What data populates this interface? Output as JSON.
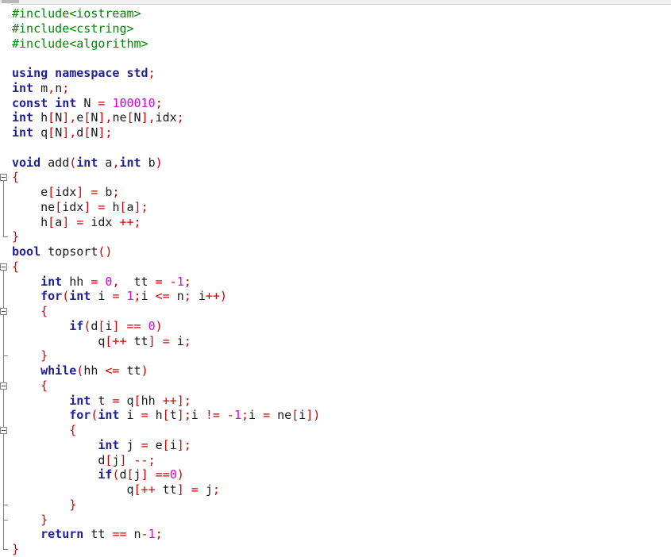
{
  "editor": {
    "lines": [
      [
        {
          "t": "#include<iostream>",
          "c": "pp"
        }
      ],
      [
        {
          "t": "#include<cstring>",
          "c": "pp"
        }
      ],
      [
        {
          "t": "#include<algorithm>",
          "c": "pp"
        }
      ],
      [],
      [
        {
          "t": "using namespace std",
          "c": "kw"
        },
        {
          "t": ";",
          "c": "pu"
        }
      ],
      [
        {
          "t": "int ",
          "c": "ty"
        },
        {
          "t": "m",
          "c": "ident"
        },
        {
          "t": ",",
          "c": "pu"
        },
        {
          "t": "n",
          "c": "ident"
        },
        {
          "t": ";",
          "c": "pu"
        }
      ],
      [
        {
          "t": "const int ",
          "c": "ty"
        },
        {
          "t": "N ",
          "c": "ident"
        },
        {
          "t": "= ",
          "c": "pu"
        },
        {
          "t": "100010",
          "c": "num"
        },
        {
          "t": ";",
          "c": "pu"
        }
      ],
      [
        {
          "t": "int ",
          "c": "ty"
        },
        {
          "t": "h",
          "c": "ident"
        },
        {
          "t": "[",
          "c": "pu"
        },
        {
          "t": "N",
          "c": "ident"
        },
        {
          "t": "],",
          "c": "pu"
        },
        {
          "t": "e",
          "c": "ident"
        },
        {
          "t": "[",
          "c": "pu"
        },
        {
          "t": "N",
          "c": "ident"
        },
        {
          "t": "],",
          "c": "pu"
        },
        {
          "t": "ne",
          "c": "ident"
        },
        {
          "t": "[",
          "c": "pu"
        },
        {
          "t": "N",
          "c": "ident"
        },
        {
          "t": "],",
          "c": "pu"
        },
        {
          "t": "idx",
          "c": "ident"
        },
        {
          "t": ";",
          "c": "pu"
        }
      ],
      [
        {
          "t": "int ",
          "c": "ty"
        },
        {
          "t": "q",
          "c": "ident"
        },
        {
          "t": "[",
          "c": "pu"
        },
        {
          "t": "N",
          "c": "ident"
        },
        {
          "t": "],",
          "c": "pu"
        },
        {
          "t": "d",
          "c": "ident"
        },
        {
          "t": "[",
          "c": "pu"
        },
        {
          "t": "N",
          "c": "ident"
        },
        {
          "t": "];",
          "c": "pu"
        }
      ],
      [],
      [
        {
          "t": "void ",
          "c": "ty"
        },
        {
          "t": "add",
          "c": "ident"
        },
        {
          "t": "(",
          "c": "pu"
        },
        {
          "t": "int ",
          "c": "ty"
        },
        {
          "t": "a",
          "c": "ident"
        },
        {
          "t": ",",
          "c": "pu"
        },
        {
          "t": "int ",
          "c": "ty"
        },
        {
          "t": "b",
          "c": "ident"
        },
        {
          "t": ")",
          "c": "pu"
        }
      ],
      [
        {
          "t": "{",
          "c": "pu"
        }
      ],
      [
        {
          "t": "    e",
          "c": "ident"
        },
        {
          "t": "[",
          "c": "pu"
        },
        {
          "t": "idx",
          "c": "ident"
        },
        {
          "t": "] = ",
          "c": "pu"
        },
        {
          "t": "b",
          "c": "ident"
        },
        {
          "t": ";",
          "c": "pu"
        }
      ],
      [
        {
          "t": "    ne",
          "c": "ident"
        },
        {
          "t": "[",
          "c": "pu"
        },
        {
          "t": "idx",
          "c": "ident"
        },
        {
          "t": "] = ",
          "c": "pu"
        },
        {
          "t": "h",
          "c": "ident"
        },
        {
          "t": "[",
          "c": "pu"
        },
        {
          "t": "a",
          "c": "ident"
        },
        {
          "t": "];",
          "c": "pu"
        }
      ],
      [
        {
          "t": "    h",
          "c": "ident"
        },
        {
          "t": "[",
          "c": "pu"
        },
        {
          "t": "a",
          "c": "ident"
        },
        {
          "t": "] = ",
          "c": "pu"
        },
        {
          "t": "idx ",
          "c": "ident"
        },
        {
          "t": "++;",
          "c": "pu"
        }
      ],
      [
        {
          "t": "}",
          "c": "pu"
        }
      ],
      [
        {
          "t": "bool ",
          "c": "ty"
        },
        {
          "t": "topsort",
          "c": "ident"
        },
        {
          "t": "()",
          "c": "pu"
        }
      ],
      [
        {
          "t": "{",
          "c": "pu"
        }
      ],
      [
        {
          "t": "    ",
          "c": "ident"
        },
        {
          "t": "int ",
          "c": "ty"
        },
        {
          "t": "hh ",
          "c": "ident"
        },
        {
          "t": "= ",
          "c": "pu"
        },
        {
          "t": "0",
          "c": "num"
        },
        {
          "t": ",  ",
          "c": "pu"
        },
        {
          "t": "tt ",
          "c": "ident"
        },
        {
          "t": "= -",
          "c": "pu"
        },
        {
          "t": "1",
          "c": "num"
        },
        {
          "t": ";",
          "c": "pu"
        }
      ],
      [
        {
          "t": "    ",
          "c": "ident"
        },
        {
          "t": "for",
          "c": "kw"
        },
        {
          "t": "(",
          "c": "pu"
        },
        {
          "t": "int ",
          "c": "ty"
        },
        {
          "t": "i ",
          "c": "ident"
        },
        {
          "t": "= ",
          "c": "pu"
        },
        {
          "t": "1",
          "c": "num"
        },
        {
          "t": ";",
          "c": "pu"
        },
        {
          "t": "i ",
          "c": "ident"
        },
        {
          "t": "<= ",
          "c": "pu"
        },
        {
          "t": "n",
          "c": "ident"
        },
        {
          "t": "; ",
          "c": "pu"
        },
        {
          "t": "i",
          "c": "ident"
        },
        {
          "t": "++)",
          "c": "pu"
        }
      ],
      [
        {
          "t": "    {",
          "c": "pu"
        }
      ],
      [
        {
          "t": "        ",
          "c": "ident"
        },
        {
          "t": "if",
          "c": "kw"
        },
        {
          "t": "(",
          "c": "pu"
        },
        {
          "t": "d",
          "c": "ident"
        },
        {
          "t": "[",
          "c": "pu"
        },
        {
          "t": "i",
          "c": "ident"
        },
        {
          "t": "] == ",
          "c": "pu"
        },
        {
          "t": "0",
          "c": "num"
        },
        {
          "t": ")",
          "c": "pu"
        }
      ],
      [
        {
          "t": "            q",
          "c": "ident"
        },
        {
          "t": "[++ ",
          "c": "pu"
        },
        {
          "t": "tt",
          "c": "ident"
        },
        {
          "t": "] = ",
          "c": "pu"
        },
        {
          "t": "i",
          "c": "ident"
        },
        {
          "t": ";",
          "c": "pu"
        }
      ],
      [
        {
          "t": "    }",
          "c": "pu"
        }
      ],
      [
        {
          "t": "    ",
          "c": "ident"
        },
        {
          "t": "while",
          "c": "kw"
        },
        {
          "t": "(",
          "c": "pu"
        },
        {
          "t": "hh ",
          "c": "ident"
        },
        {
          "t": "<= ",
          "c": "pu"
        },
        {
          "t": "tt",
          "c": "ident"
        },
        {
          "t": ")",
          "c": "pu"
        }
      ],
      [
        {
          "t": "    {",
          "c": "pu"
        }
      ],
      [
        {
          "t": "        ",
          "c": "ident"
        },
        {
          "t": "int ",
          "c": "ty"
        },
        {
          "t": "t ",
          "c": "ident"
        },
        {
          "t": "= ",
          "c": "pu"
        },
        {
          "t": "q",
          "c": "ident"
        },
        {
          "t": "[",
          "c": "pu"
        },
        {
          "t": "hh ",
          "c": "ident"
        },
        {
          "t": "++];",
          "c": "pu"
        }
      ],
      [
        {
          "t": "        ",
          "c": "ident"
        },
        {
          "t": "for",
          "c": "kw"
        },
        {
          "t": "(",
          "c": "pu"
        },
        {
          "t": "int ",
          "c": "ty"
        },
        {
          "t": "i ",
          "c": "ident"
        },
        {
          "t": "= ",
          "c": "pu"
        },
        {
          "t": "h",
          "c": "ident"
        },
        {
          "t": "[",
          "c": "pu"
        },
        {
          "t": "t",
          "c": "ident"
        },
        {
          "t": "];",
          "c": "pu"
        },
        {
          "t": "i ",
          "c": "ident"
        },
        {
          "t": "!= -",
          "c": "pu"
        },
        {
          "t": "1",
          "c": "num"
        },
        {
          "t": ";",
          "c": "pu"
        },
        {
          "t": "i ",
          "c": "ident"
        },
        {
          "t": "= ",
          "c": "pu"
        },
        {
          "t": "ne",
          "c": "ident"
        },
        {
          "t": "[",
          "c": "pu"
        },
        {
          "t": "i",
          "c": "ident"
        },
        {
          "t": "])",
          "c": "pu"
        }
      ],
      [
        {
          "t": "        {",
          "c": "pu"
        }
      ],
      [
        {
          "t": "            ",
          "c": "ident"
        },
        {
          "t": "int ",
          "c": "ty"
        },
        {
          "t": "j ",
          "c": "ident"
        },
        {
          "t": "= ",
          "c": "pu"
        },
        {
          "t": "e",
          "c": "ident"
        },
        {
          "t": "[",
          "c": "pu"
        },
        {
          "t": "i",
          "c": "ident"
        },
        {
          "t": "];",
          "c": "pu"
        }
      ],
      [
        {
          "t": "            d",
          "c": "ident"
        },
        {
          "t": "[",
          "c": "pu"
        },
        {
          "t": "j",
          "c": "ident"
        },
        {
          "t": "] --;",
          "c": "pu"
        }
      ],
      [
        {
          "t": "            ",
          "c": "ident"
        },
        {
          "t": "if",
          "c": "kw"
        },
        {
          "t": "(",
          "c": "pu"
        },
        {
          "t": "d",
          "c": "ident"
        },
        {
          "t": "[",
          "c": "pu"
        },
        {
          "t": "j",
          "c": "ident"
        },
        {
          "t": "] ==",
          "c": "pu"
        },
        {
          "t": "0",
          "c": "num"
        },
        {
          "t": ")",
          "c": "pu"
        }
      ],
      [
        {
          "t": "                q",
          "c": "ident"
        },
        {
          "t": "[++ ",
          "c": "pu"
        },
        {
          "t": "tt",
          "c": "ident"
        },
        {
          "t": "] = ",
          "c": "pu"
        },
        {
          "t": "j",
          "c": "ident"
        },
        {
          "t": ";",
          "c": "pu"
        }
      ],
      [
        {
          "t": "        }",
          "c": "pu"
        }
      ],
      [
        {
          "t": "    }",
          "c": "pu"
        }
      ],
      [
        {
          "t": "    ",
          "c": "ident"
        },
        {
          "t": "return ",
          "c": "kw"
        },
        {
          "t": "tt ",
          "c": "ident"
        },
        {
          "t": "== ",
          "c": "pu"
        },
        {
          "t": "n",
          "c": "ident"
        },
        {
          "t": "-",
          "c": "pu"
        },
        {
          "t": "1",
          "c": "num"
        },
        {
          "t": ";",
          "c": "pu"
        }
      ],
      [
        {
          "t": "}",
          "c": "pu"
        }
      ]
    ]
  }
}
